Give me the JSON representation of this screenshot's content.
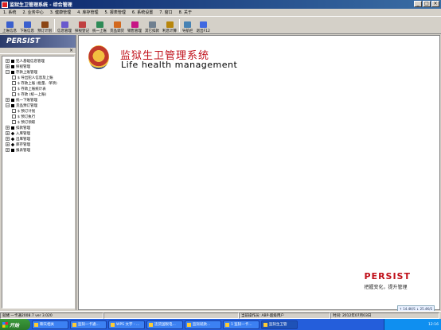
{
  "window": {
    "title": "监狱生卫管理系统 - 综合管理",
    "buttons": [
      "minimize",
      "maximize",
      "close"
    ]
  },
  "menubar": [
    "1. 系统",
    "2. 业务中心",
    "3. 健康管理",
    "4. 库存管理",
    "5. 报表管理",
    "6. 系统设置",
    "7. 窗口",
    "8. 关于"
  ],
  "toolbar": [
    {
      "label": "上账信息",
      "icon": "account-icon",
      "color": "#3a5fcd"
    },
    {
      "label": "下账信息",
      "icon": "account-down-icon",
      "color": "#3a5fcd"
    },
    {
      "label": "预订计划",
      "icon": "plan-icon",
      "color": "#8b4513"
    },
    {
      "label": "信息管理",
      "icon": "info-icon",
      "color": "#6a5acd"
    },
    {
      "label": "探视登记",
      "icon": "visit-icon",
      "color": "#c04040"
    },
    {
      "label": "统一上账",
      "icon": "unified-account-icon",
      "color": "#2e8b57"
    },
    {
      "label": "货品调货",
      "icon": "goods-icon",
      "color": "#d2691e"
    },
    {
      "label": "销售管理",
      "icon": "sales-icon",
      "color": "#c71585"
    },
    {
      "label": "其它扣款",
      "icon": "deduct-icon",
      "color": "#708090"
    },
    {
      "label": "利息计算",
      "icon": "interest-icon",
      "color": "#b8860b"
    },
    {
      "label": "导航栏",
      "icon": "nav-icon",
      "color": "#4682b4"
    },
    {
      "label": "退出F12",
      "icon": "exit-icon",
      "color": "#4169e1"
    }
  ],
  "sidebar": {
    "banner": "PERSIST",
    "close_glyph": "×",
    "tree": [
      {
        "level": 1,
        "expander": "+",
        "icon": "square",
        "label": "犯人基础信息管理"
      },
      {
        "level": 1,
        "expander": "+",
        "icon": "square",
        "label": "探视管理"
      },
      {
        "level": 1,
        "expander": "−",
        "icon": "square",
        "label": "存款上账管理"
      },
      {
        "level": 2,
        "expander": "",
        "icon": "file",
        "label": "$ 导出犯人信息及上账"
      },
      {
        "level": 2,
        "expander": "",
        "icon": "file",
        "label": "$ 存款上账 (批量、单项)"
      },
      {
        "level": 2,
        "expander": "",
        "icon": "file",
        "label": "$ 存款上账统计表"
      },
      {
        "level": 2,
        "expander": "",
        "icon": "file",
        "label": "$ 存款 (统一上账)"
      },
      {
        "level": 1,
        "expander": "+",
        "icon": "square",
        "label": "统一下账管理"
      },
      {
        "level": 1,
        "expander": "−",
        "icon": "square",
        "label": "货品预订管理"
      },
      {
        "level": 2,
        "expander": "",
        "icon": "file",
        "label": "$ 预订计划"
      },
      {
        "level": 2,
        "expander": "",
        "icon": "file",
        "label": "$ 预订执行"
      },
      {
        "level": 2,
        "expander": "",
        "icon": "file",
        "label": "$ 预订领取"
      },
      {
        "level": 1,
        "expander": "+",
        "icon": "square",
        "label": "扣款管理"
      },
      {
        "level": 1,
        "expander": "+",
        "icon": "diamond",
        "label": "入库管理"
      },
      {
        "level": 1,
        "expander": "+",
        "icon": "diamond",
        "label": "出库管理"
      },
      {
        "level": 1,
        "expander": "+",
        "icon": "diamond",
        "label": "库存管理"
      },
      {
        "level": 1,
        "expander": "+",
        "icon": "square",
        "label": "报表管理"
      }
    ]
  },
  "main": {
    "title": "监狱生卫管理系统",
    "subtitle": "Life health management",
    "brand_name": "PERSIST",
    "brand_slogan": "把握变化，提升管理"
  },
  "statusbar": {
    "version": "就绪 一卡通2008.7 ver 3.020",
    "operator": "当前操作员: ABP-超级用户",
    "datetime": "时间: 2012年07月03日"
  },
  "speed_badge": "↑ 14.4K/S  ↓ 25.4K/S",
  "taskbar": {
    "start": "开始",
    "tasks": [
      {
        "label": "聊天相关",
        "active": false
      },
      {
        "label": "监狱一卡通...",
        "active": false
      },
      {
        "label": "WPS 文字 - ...",
        "active": false
      },
      {
        "label": "违货国税电...",
        "active": false
      },
      {
        "label": "监狱就款...",
        "active": false
      },
      {
        "label": "1 监狱一卡...",
        "active": false
      },
      {
        "label": "监狱生卫管",
        "active": true
      }
    ],
    "clock": "12:16"
  },
  "colors": {
    "title_red": "#c0101a",
    "titlebar_blue": "#0a246a",
    "taskbar_blue": "#245edb"
  }
}
